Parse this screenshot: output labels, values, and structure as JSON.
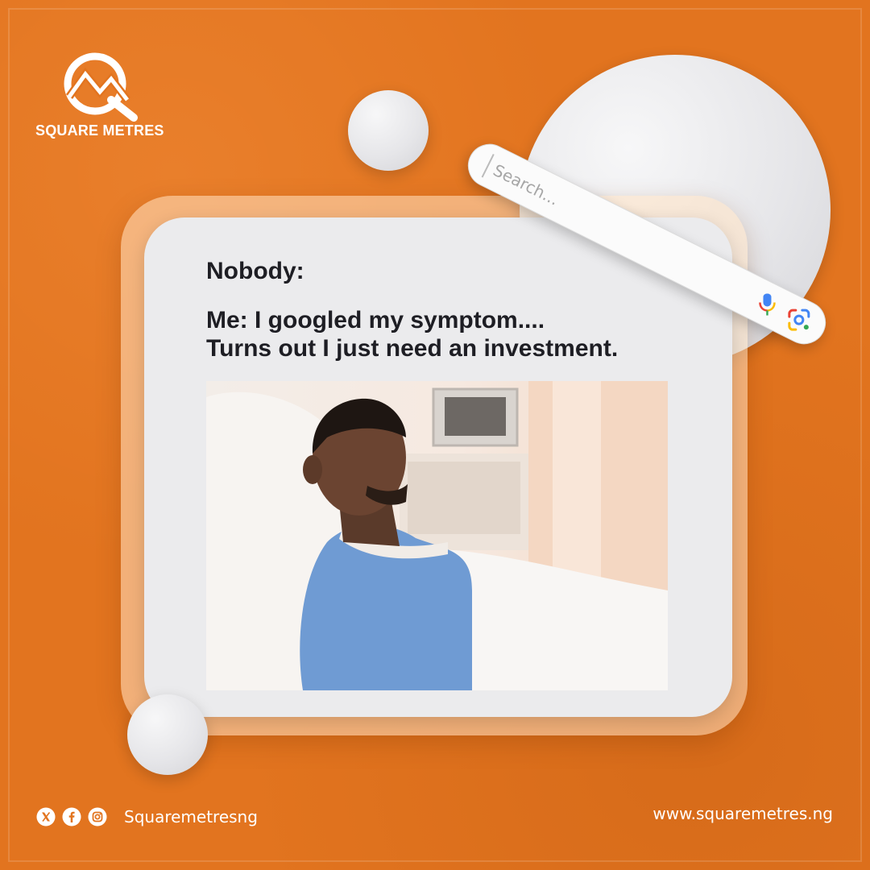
{
  "brand": {
    "name": "SQUARE METRES",
    "logo_icon": "square-metres-logo-icon"
  },
  "search": {
    "placeholder": "Search...",
    "icons": [
      "mic-icon",
      "lens-icon"
    ]
  },
  "post": {
    "line1": "Nobody:",
    "line2": "Me: I googled my symptom....",
    "line3": "Turns out I just need an investment."
  },
  "footer": {
    "social_icons": [
      "x-icon",
      "facebook-icon",
      "instagram-icon"
    ],
    "handle": "Squaremetresng",
    "website": "www.squaremetres.ng"
  },
  "colors": {
    "background": "#e2741f",
    "card": "#ebebed",
    "text": "#1e1e24",
    "accent_white": "#ffffff"
  }
}
